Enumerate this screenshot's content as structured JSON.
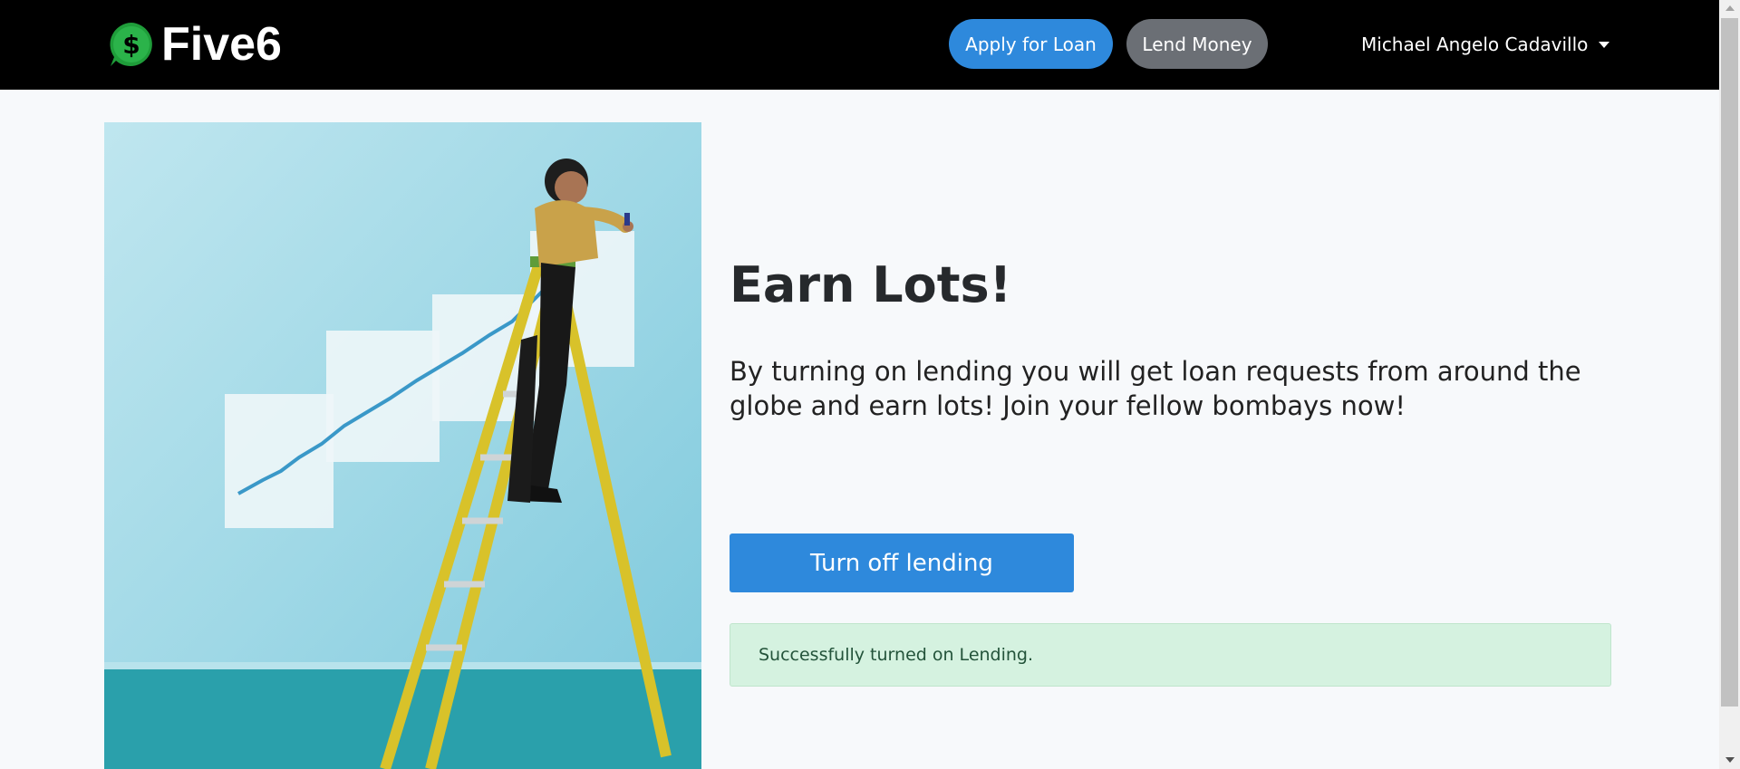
{
  "navbar": {
    "brand_name": "Five6",
    "logo_symbol": "$",
    "apply_button": "Apply for Loan",
    "lend_button": "Lend Money",
    "user_name": "Michael Angelo Cadavillo"
  },
  "main": {
    "headline": "Earn Lots!",
    "description": "By turning on lending you will get loan requests from around the globe and earn lots! Join your fellow bombays now!",
    "toggle_button": "Turn off lending",
    "alert_message": "Successfully turned on Lending."
  },
  "colors": {
    "primary": "#2e89dc",
    "secondary": "#6b6f75",
    "alert_bg": "#d5f2e0",
    "navbar_bg": "#000000",
    "logo_green": "#1f9d3a"
  }
}
